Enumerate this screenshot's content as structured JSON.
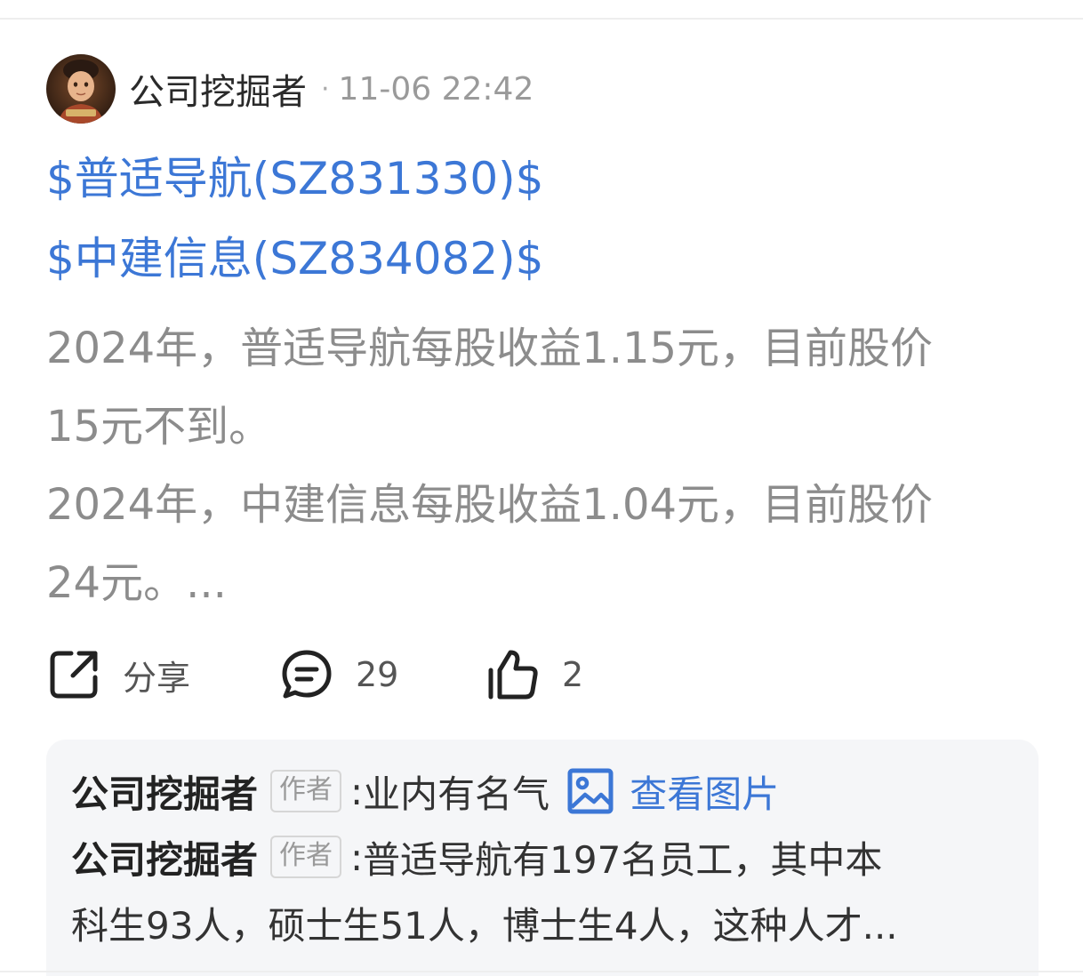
{
  "post": {
    "author": "公司挖掘者",
    "separator": "·",
    "time": "11-06 22:42",
    "stocks": [
      "$普适导航(SZ831330)$",
      "$中建信息(SZ834082)$"
    ],
    "body_lines": [
      "2024年，普适导航每股收益1.15元，目前股价",
      "15元不到。",
      "2024年，中建信息每股收益1.04元，目前股价",
      "24元。..."
    ]
  },
  "actions": {
    "share_label": "分享",
    "comment_count": "29",
    "like_count": "2",
    "icons": [
      "share-icon",
      "comment-icon",
      "like-icon"
    ]
  },
  "comments": [
    {
      "author": "公司挖掘者",
      "tag": "作者",
      "colon": ":",
      "text": "业内有名气",
      "image_link_label": "查看图片",
      "image_icon": "image-icon"
    },
    {
      "author": "公司挖掘者",
      "tag": "作者",
      "colon": ":",
      "text": "普适导航有197名员工，其中本",
      "text_cont": "科生93人，硕士生51人，博士生4人，这种人才..."
    }
  ],
  "colors": {
    "link": "#3c77d6",
    "body_text": "#8c8c8c",
    "comment_bg": "#f5f6f8"
  }
}
